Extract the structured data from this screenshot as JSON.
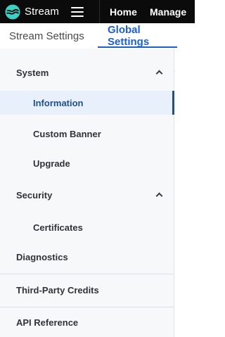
{
  "app": {
    "name": "Stream"
  },
  "topbar": {
    "logo_icon": "stream-logo-icon",
    "menu_icon": "hamburger-menu-icon",
    "nav": [
      "Home",
      "Manage"
    ]
  },
  "tabs": [
    {
      "label": "Stream Settings",
      "active": false
    },
    {
      "label": "Global Settings",
      "active": true
    }
  ],
  "sidebar": {
    "items": [
      {
        "label": "System",
        "type": "group",
        "expanded": true,
        "icon": "chevron-up-icon"
      },
      {
        "label": "Information",
        "type": "sub",
        "active": true
      },
      {
        "label": "Custom Banner",
        "type": "sub"
      },
      {
        "label": "Upgrade",
        "type": "sub"
      },
      {
        "label": "Security",
        "type": "group",
        "expanded": true,
        "icon": "chevron-up-icon"
      },
      {
        "label": "Certificates",
        "type": "sub"
      },
      {
        "label": "Diagnostics",
        "type": "group"
      },
      {
        "label": "Third-Party Credits",
        "type": "group"
      },
      {
        "label": "API Reference",
        "type": "group"
      }
    ]
  },
  "colors": {
    "topbar_bg": "#0b0b0b",
    "accent": "#1d5fd1",
    "active_item_bg": "#e8f1fb",
    "active_item_text": "#1f4f8f",
    "logo": "#3fd0c4"
  }
}
